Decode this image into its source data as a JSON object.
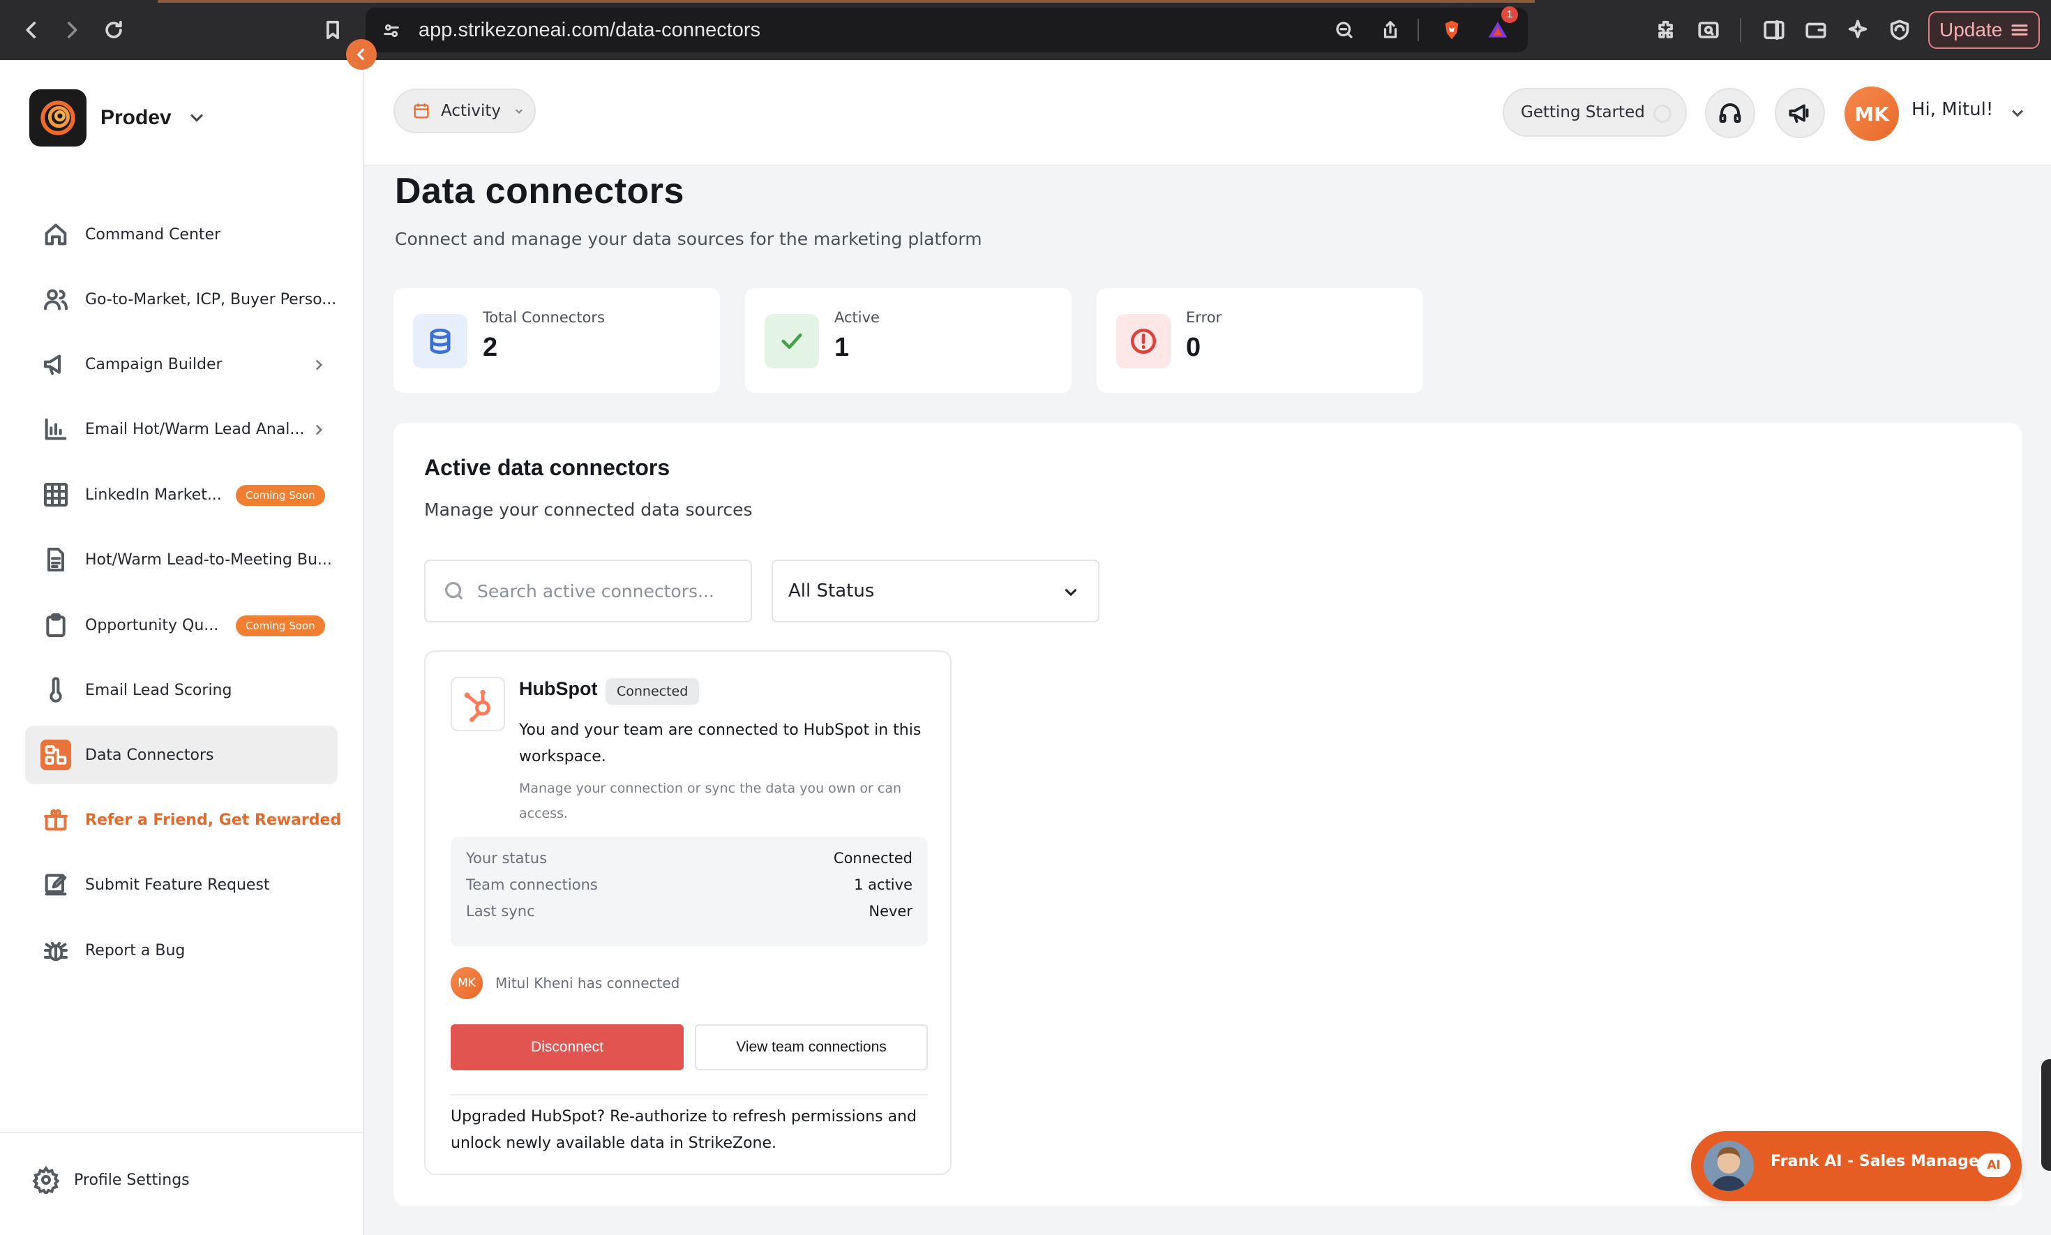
{
  "browser": {
    "url": "app.strikezoneai.com/data-connectors",
    "notification_count": "1",
    "update_label": "Update"
  },
  "sidebar": {
    "workspace": "Prodev",
    "items": [
      {
        "label": "Command Center",
        "icon": "home-icon"
      },
      {
        "label": "Go-to-Market, ICP, Buyer Perso...",
        "icon": "users-icon"
      },
      {
        "label": "Campaign Builder",
        "icon": "megaphone-icon"
      },
      {
        "label": "Email Hot/Warm Lead Anal...",
        "icon": "bar-chart-icon"
      },
      {
        "label": "LinkedIn Market...",
        "icon": "grid-icon",
        "badge": "Coming Soon"
      },
      {
        "label": "Hot/Warm Lead-to-Meeting Bu...",
        "icon": "document-icon"
      },
      {
        "label": "Opportunity Qu...",
        "icon": "clipboard-icon",
        "badge": "Coming Soon"
      },
      {
        "label": "Email Lead Scoring",
        "icon": "thermometer-icon"
      },
      {
        "label": "Data Connectors",
        "icon": "connector-icon",
        "active": true
      },
      {
        "label": "Refer a Friend, Get Rewarded",
        "icon": "gift-icon"
      },
      {
        "label": "Submit Feature Request",
        "icon": "edit-icon"
      },
      {
        "label": "Report a Bug",
        "icon": "bug-icon"
      }
    ],
    "profile_settings": "Profile Settings"
  },
  "header": {
    "activity": "Activity",
    "getting_started": "Getting Started",
    "avatar_initials": "MK",
    "greeting": "Hi, Mitul!"
  },
  "page": {
    "title": "Data connectors",
    "subtitle": "Connect and manage your data sources for the marketing platform"
  },
  "stats": [
    {
      "label": "Total Connectors",
      "value": "2",
      "icon": "database-icon",
      "color": "#3b6fd8",
      "bg": "#e7effc"
    },
    {
      "label": "Active",
      "value": "1",
      "icon": "check-icon",
      "color": "#43a047",
      "bg": "#e4f4e4"
    },
    {
      "label": "Error",
      "value": "0",
      "icon": "alert-circle-icon",
      "color": "#e0413b",
      "bg": "#fde7e7"
    }
  ],
  "panel": {
    "title": "Active data connectors",
    "subtitle": "Manage your connected data sources",
    "search_placeholder": "Search active connectors...",
    "status_filter": "All Status"
  },
  "connector": {
    "name": "HubSpot",
    "status_chip": "Connected",
    "description": "You and your team are connected to HubSpot in this workspace.",
    "sub_description": "Manage your connection or sync the data you own or can access.",
    "details": [
      {
        "key": "Your status",
        "value": "Connected"
      },
      {
        "key": "Team connections",
        "value": "1 active"
      },
      {
        "key": "Last sync",
        "value": "Never"
      }
    ],
    "connected_by_initials": "MK",
    "connected_by": "Mitul Kheni has connected",
    "disconnect_label": "Disconnect",
    "view_team_label": "View team connections",
    "upgrade_note": "Upgraded HubSpot? Re-authorize to refresh permissions and unlock newly available data in StrikeZone."
  },
  "chat": {
    "label": "Frank AI - Sales Manager",
    "chip": "AI"
  },
  "colors": {
    "accent": "#e8743b",
    "danger": "#e25450"
  }
}
